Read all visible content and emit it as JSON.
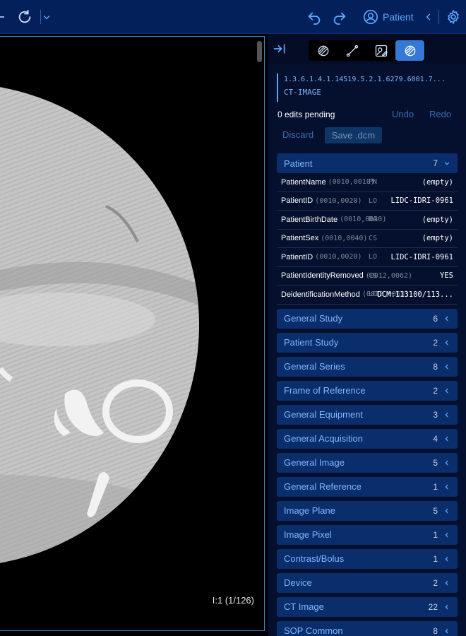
{
  "toolbar": {
    "patient_label": "Patient"
  },
  "viewport": {
    "frame_label": "I:1 (1/126)"
  },
  "panel": {
    "uid": "1.3.6.1.4.1.14519.5.2.1.6279.6001.7...",
    "modality": "CT-IMAGE",
    "edits_pending": "0 edits pending",
    "undo": "Undo",
    "redo": "Redo",
    "discard": "Discard",
    "save": "Save .dcm",
    "open_group": {
      "name": "Patient",
      "count": "7"
    },
    "attributes": [
      {
        "name": "PatientName",
        "tag": "(0010,0010)",
        "vr": "PN",
        "value": "(empty)"
      },
      {
        "name": "PatientID",
        "tag": "(0010,0020)",
        "vr": "LO",
        "value": "LIDC-IDRI-0961"
      },
      {
        "name": "PatientBirthDate",
        "tag": "(0010,0030)",
        "vr": "DA",
        "value": "(empty)"
      },
      {
        "name": "PatientSex",
        "tag": "(0010,0040)",
        "vr": "CS",
        "value": "(empty)"
      },
      {
        "name": "PatientID",
        "tag": "(0010,0020)",
        "vr": "LO",
        "value": "LIDC-IDRI-0961"
      },
      {
        "name": "PatientIdentityRemoved",
        "tag": "(0012,0062)",
        "vr": "CS",
        "value": "YES"
      },
      {
        "name": "DeidentificationMethod",
        "tag": "(0012,0063)",
        "vr": "LO",
        "value": "DCM:113100/113..."
      }
    ],
    "groups": [
      {
        "name": "General Study",
        "count": "6"
      },
      {
        "name": "Patient Study",
        "count": "2"
      },
      {
        "name": "General Series",
        "count": "8"
      },
      {
        "name": "Frame of Reference",
        "count": "2"
      },
      {
        "name": "General Equipment",
        "count": "3"
      },
      {
        "name": "General Acquisition",
        "count": "4"
      },
      {
        "name": "General Image",
        "count": "5"
      },
      {
        "name": "General Reference",
        "count": "1"
      },
      {
        "name": "Image Plane",
        "count": "5"
      },
      {
        "name": "Image Pixel",
        "count": "1"
      },
      {
        "name": "Contrast/Bolus",
        "count": "1"
      },
      {
        "name": "Device",
        "count": "2"
      },
      {
        "name": "CT Image",
        "count": "22"
      },
      {
        "name": "SOP Common",
        "count": "8"
      }
    ]
  },
  "colors": {
    "toolbar_bg": "#04205a",
    "accent": "#5aa9ff",
    "active_tool": "#3678d6",
    "group_bg": "#0a2d6b"
  }
}
